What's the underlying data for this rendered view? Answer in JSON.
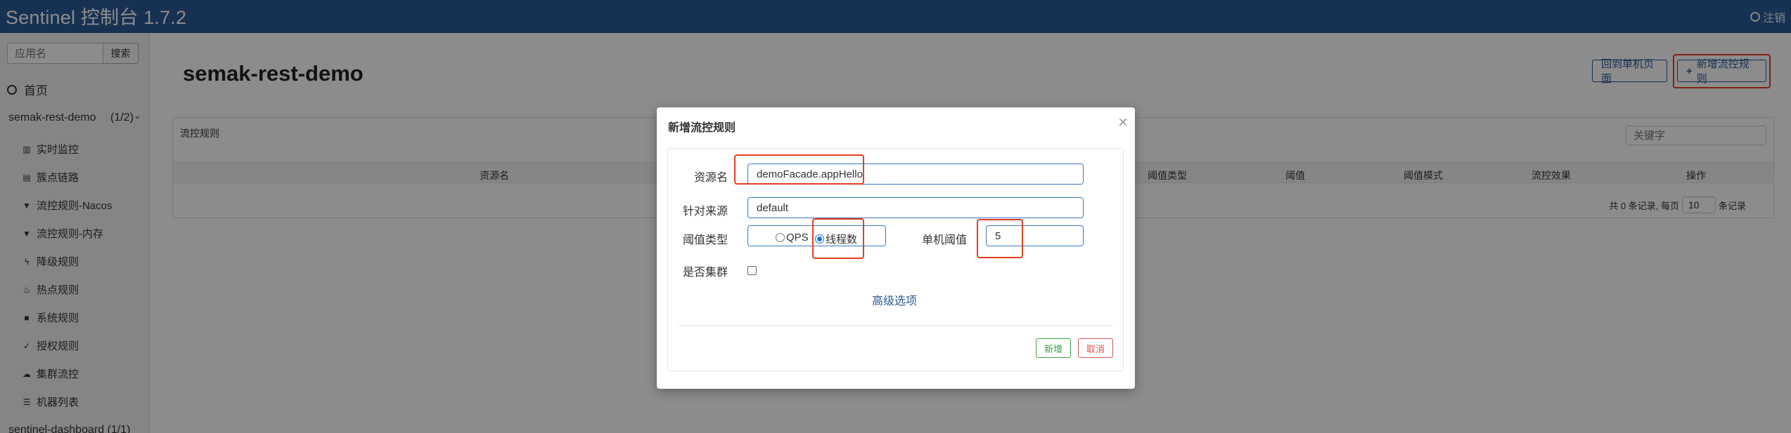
{
  "header": {
    "brand": "Sentinel 控制台 1.7.2",
    "logout": "注销",
    "logout_icon": "logout-icon"
  },
  "sidebar": {
    "search_placeholder": "应用名",
    "search_button": "搜索",
    "home": "首页",
    "app": {
      "name": "semak-rest-demo",
      "count": "(1/2)"
    },
    "items": [
      {
        "label": "实时监控",
        "icon": "bar-chart-icon"
      },
      {
        "label": "簇点链路",
        "icon": "list-icon"
      },
      {
        "label": "流控规则-Nacos",
        "icon": "filter-icon"
      },
      {
        "label": "流控规则-内存",
        "icon": "filter-icon"
      },
      {
        "label": "降级规则",
        "icon": "flash-icon"
      },
      {
        "label": "热点规则",
        "icon": "fire-icon"
      },
      {
        "label": "系统规则",
        "icon": "lock-icon"
      },
      {
        "label": "授权规则",
        "icon": "check-circle-icon"
      },
      {
        "label": "集群流控",
        "icon": "cloud-icon"
      },
      {
        "label": "机器列表",
        "icon": "th-list-icon"
      }
    ],
    "app2": {
      "name": "sentinel-dashboard",
      "count": "(1/1)"
    }
  },
  "main": {
    "title": "semak-rest-demo",
    "back_button": "回到单机页面",
    "add_button": "新增流控规则",
    "panel": {
      "title": "流控规则",
      "search_placeholder": "关键字",
      "columns": [
        "资源名",
        "阈值类型",
        "阈值",
        "阈值模式",
        "流控效果",
        "操作"
      ],
      "pager": {
        "prefix": "共 0 条记录, 每页",
        "page_size": "10",
        "suffix": "条记录"
      }
    }
  },
  "modal": {
    "title": "新增流控规则",
    "close": "×",
    "resource_label": "资源名",
    "resource_value": "demoFacade.appHello",
    "source_label": "针对来源",
    "source_value": "default",
    "threshold_type_label": "阈值类型",
    "qps_label": "QPS",
    "threads_label": "线程数",
    "selected_grade": "线程数",
    "threshold_label": "单机阈值",
    "threshold_value": "5",
    "cluster_label": "是否集群",
    "cluster_checked": false,
    "advanced_link": "高级选项",
    "add_button": "新增",
    "cancel_button": "取消"
  },
  "colors": {
    "nav": "#2a5a96",
    "highlight": "#e53e20",
    "success": "#3aa14a",
    "danger": "#d9534f"
  }
}
